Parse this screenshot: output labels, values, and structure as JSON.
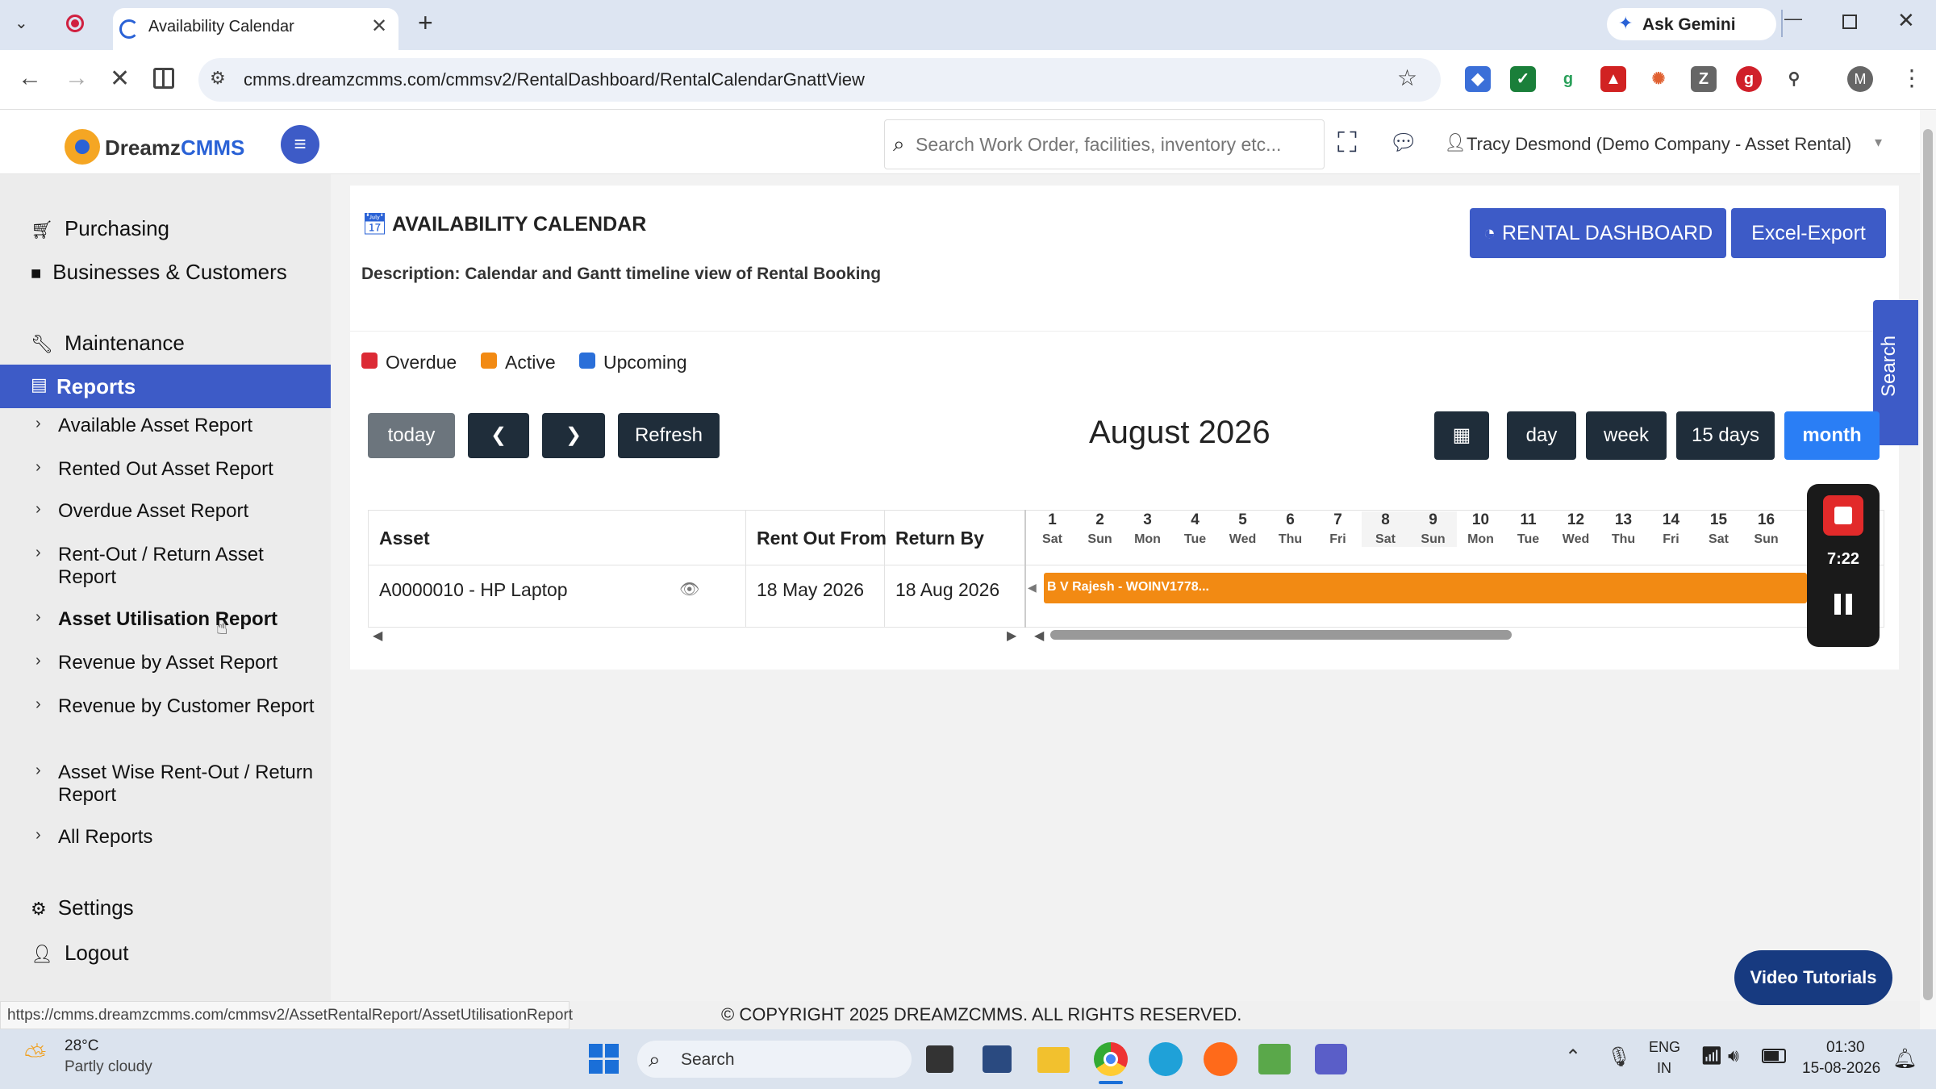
{
  "browser": {
    "tab_title": "Availability Calendar",
    "url": "cmms.dreamzcmms.com/cmmsv2/RentalDashboard/RentalCalendarGnattView",
    "ask_gemini": "Ask Gemini",
    "profile_initial": "M",
    "status_url": "https://cmms.dreamzcmms.com/cmmsv2/AssetRentalReport/AssetUtilisationReport",
    "colors": {
      "tab_bar": "#dde5f2",
      "omnibox": "#edf1f8"
    }
  },
  "app": {
    "logo_text_a": "Dreamz",
    "logo_text_b": "CMMS",
    "search_placeholder": "Search Work Order, facilities, inventory etc...",
    "user_label": "Tracy Desmond (Demo Company - Asset Rental)"
  },
  "sidebar": {
    "top_items": [
      {
        "label": "Purchasing",
        "icon": "cart-icon"
      },
      {
        "label": "Businesses & Customers",
        "icon": "video-icon"
      },
      {
        "label": "Maintenance",
        "icon": "wrench-icon"
      }
    ],
    "active_item": {
      "label": "Reports",
      "icon": "file-icon"
    },
    "report_items": [
      {
        "label": "Available Asset Report"
      },
      {
        "label": "Rented Out Asset Report"
      },
      {
        "label": "Overdue Asset Report"
      },
      {
        "label": "Rent-Out / Return Asset Report"
      },
      {
        "label": "Asset Utilisation Report"
      },
      {
        "label": "Revenue by Asset Report"
      },
      {
        "label": "Revenue by Customer Report"
      },
      {
        "label": "Asset Wise Rent-Out / Return Report"
      },
      {
        "label": "All Reports"
      }
    ],
    "bottom_items": [
      {
        "label": "Settings",
        "icon": "gear-icon"
      },
      {
        "label": "Logout",
        "icon": "user-icon"
      }
    ],
    "colors": {
      "active_bg": "#3d5bc7"
    }
  },
  "page": {
    "title": "AVAILABILITY CALENDAR",
    "description": "Description: Calendar and Gantt timeline view of Rental Booking",
    "rental_dashboard_btn": "RENTAL DASHBOARD",
    "excel_export_btn": "Excel-Export",
    "search_side_tab": "Search",
    "legend": [
      {
        "label": "Overdue",
        "color": "#dc2a35"
      },
      {
        "label": "Active",
        "color": "#f28a13"
      },
      {
        "label": "Upcoming",
        "color": "#2a6fd9"
      }
    ],
    "toolbar": {
      "today": "today",
      "refresh": "Refresh",
      "month_title": "August 2026",
      "views": [
        "day",
        "week",
        "15 days",
        "month"
      ],
      "active_view": "month"
    },
    "table": {
      "headers": [
        "Asset",
        "Rent Out From",
        "Return By"
      ],
      "rows": [
        {
          "asset": "A0000010 - HP Laptop",
          "rent_out_from": "18 May 2026",
          "return_by": "18 Aug 2026"
        }
      ]
    },
    "days": [
      {
        "num": "1",
        "name": "Sat"
      },
      {
        "num": "2",
        "name": "Sun"
      },
      {
        "num": "3",
        "name": "Mon"
      },
      {
        "num": "4",
        "name": "Tue"
      },
      {
        "num": "5",
        "name": "Wed"
      },
      {
        "num": "6",
        "name": "Thu"
      },
      {
        "num": "7",
        "name": "Fri"
      },
      {
        "num": "8",
        "name": "Sat"
      },
      {
        "num": "9",
        "name": "Sun"
      },
      {
        "num": "10",
        "name": "Mon"
      },
      {
        "num": "11",
        "name": "Tue"
      },
      {
        "num": "12",
        "name": "Wed"
      },
      {
        "num": "13",
        "name": "Thu"
      },
      {
        "num": "14",
        "name": "Fri"
      },
      {
        "num": "15",
        "name": "Sat"
      },
      {
        "num": "16",
        "name": "Sun"
      }
    ],
    "booking_label": "B V Rajesh - WOINV1778...",
    "recorder_time": "7:22",
    "video_tutorials": "Video Tutorials",
    "copyright": "© COPYRIGHT 2025 DREAMZCMMS. ALL RIGHTS RESERVED."
  },
  "taskbar": {
    "temp": "28°C",
    "weather": "Partly cloudy",
    "search": "Search",
    "lang1": "ENG",
    "lang2": "IN",
    "time": "01:30",
    "date": "15-08-2026"
  }
}
